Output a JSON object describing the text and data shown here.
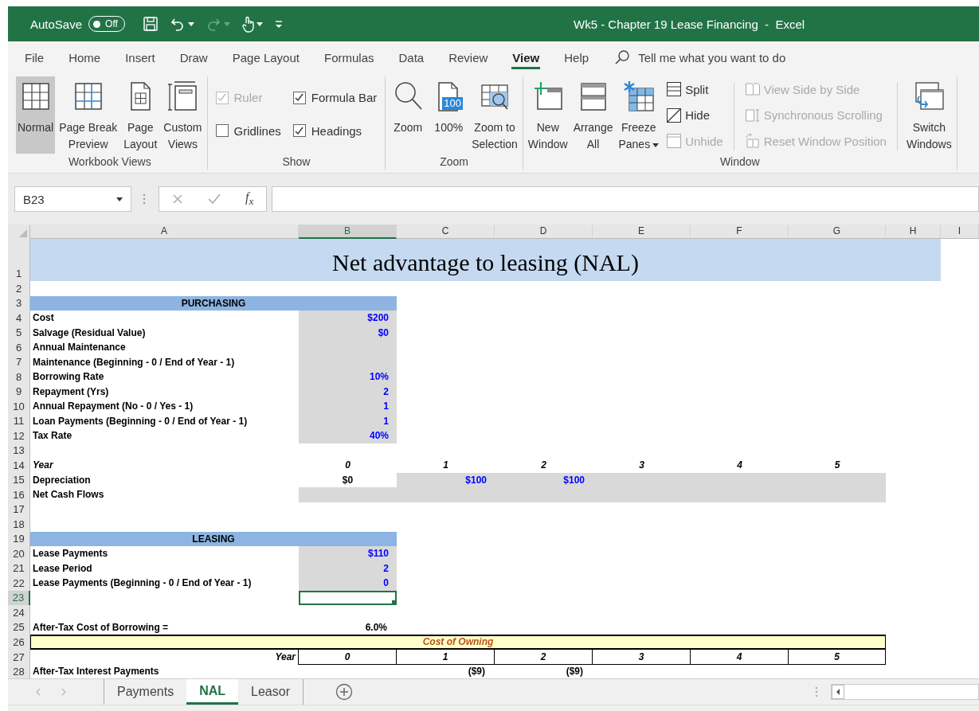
{
  "title_bar": {
    "autosave_label": "AutoSave",
    "autosave": {
      "text": "Off",
      "on": false
    },
    "quick_access": [
      {
        "kind": "save",
        "dropdown": false,
        "disabled": false
      },
      {
        "kind": "undo",
        "dropdown": true,
        "disabled": false
      },
      {
        "kind": "redo",
        "dropdown": true,
        "disabled": true
      },
      {
        "kind": "touch",
        "dropdown": true,
        "disabled": false
      },
      {
        "kind": "customize",
        "dropdown": false,
        "disabled": false
      }
    ],
    "title": "Wk5 - Chapter 19 Lease Financing  -  Excel"
  },
  "menu_tabs": [
    {
      "label": "File",
      "selected": false
    },
    {
      "label": "Home",
      "selected": false
    },
    {
      "label": "Insert",
      "selected": false
    },
    {
      "label": "Draw",
      "selected": false
    },
    {
      "label": "Page Layout",
      "selected": false
    },
    {
      "label": "Formulas",
      "selected": false
    },
    {
      "label": "Data",
      "selected": false
    },
    {
      "label": "Review",
      "selected": false
    },
    {
      "label": "View",
      "selected": true
    },
    {
      "label": "Help",
      "selected": false
    }
  ],
  "search": {
    "placeholder": "Tell me what you want to do"
  },
  "ribbon": {
    "groups": [
      {
        "label": "Workbook Views",
        "items": [
          {
            "kind": "large",
            "label": "Normal",
            "selected": true
          },
          {
            "kind": "large",
            "label": "Page Break\nPreview",
            "selected": false
          },
          {
            "kind": "large",
            "label": "Page\nLayout",
            "selected": false
          },
          {
            "kind": "large",
            "label": "Custom\nViews",
            "selected": false
          }
        ]
      },
      {
        "label": "Show",
        "items": [
          {
            "kind": "check",
            "label": "Ruler",
            "checked": true,
            "disabled": true
          },
          {
            "kind": "check",
            "label": "Gridlines",
            "checked": false,
            "disabled": false
          },
          {
            "kind": "check",
            "label": "Formula Bar",
            "checked": true,
            "disabled": false
          },
          {
            "kind": "check",
            "label": "Headings",
            "checked": true,
            "disabled": false
          }
        ]
      },
      {
        "label": "Zoom",
        "items": [
          {
            "kind": "large",
            "label": "Zoom",
            "selected": false
          },
          {
            "kind": "large",
            "label": "100%",
            "badge": "100",
            "selected": false
          },
          {
            "kind": "large",
            "label": "Zoom to\nSelection",
            "selected": false
          }
        ]
      },
      {
        "label": "Window",
        "items": [
          {
            "kind": "large",
            "label": "New\nWindow",
            "selected": false
          },
          {
            "kind": "large",
            "label": "Arrange\nAll",
            "selected": false
          },
          {
            "kind": "large",
            "label": "Freeze\nPanes",
            "dropdown": true,
            "selected": false
          },
          {
            "kind": "small",
            "label": "Split",
            "disabled": false
          },
          {
            "kind": "small",
            "label": "Hide",
            "disabled": false
          },
          {
            "kind": "small",
            "label": "Unhide",
            "disabled": true
          },
          {
            "kind": "small",
            "label": "View Side by Side",
            "disabled": true
          },
          {
            "kind": "small",
            "label": "Synchronous Scrolling",
            "disabled": true
          },
          {
            "kind": "small",
            "label": "Reset Window Position",
            "disabled": true
          },
          {
            "kind": "large",
            "label": "Switch\nWindows",
            "selected": false
          }
        ]
      }
    ]
  },
  "formula_bar": {
    "name_box": "B23",
    "function_label": "f$_{x}$"
  },
  "sheet": {
    "columns": [
      {
        "label": "A",
        "selected": false
      },
      {
        "label": "B",
        "selected": true
      },
      {
        "label": "C",
        "selected": false
      },
      {
        "label": "D",
        "selected": false
      },
      {
        "label": "E",
        "selected": false
      },
      {
        "label": "F",
        "selected": false
      },
      {
        "label": "G",
        "selected": false
      },
      {
        "label": "H",
        "selected": false
      },
      {
        "label": "I",
        "selected": false
      }
    ],
    "rows": [
      {
        "number": "1",
        "selected": false,
        "cells": [
          {
            "kind": "title",
            "text": "Net advantage to leasing (NAL)"
          }
        ]
      },
      {
        "number": "2",
        "selected": false
      },
      {
        "number": "3",
        "selected": false,
        "cells": [
          {
            "kind": "section",
            "text": "PURCHASING"
          }
        ]
      },
      {
        "number": "4",
        "selected": false,
        "cells": [
          {
            "kind": "label",
            "text": "Cost"
          },
          {
            "kind": "input",
            "text": "$200"
          }
        ]
      },
      {
        "number": "5",
        "selected": false,
        "cells": [
          {
            "kind": "label",
            "text": "Salvage (Residual Value)"
          },
          {
            "kind": "input",
            "text": "$0"
          }
        ]
      },
      {
        "number": "6",
        "selected": false,
        "cells": [
          {
            "kind": "label",
            "text": "Annual Maintenance"
          },
          {
            "kind": "input"
          }
        ]
      },
      {
        "number": "7",
        "selected": false,
        "cells": [
          {
            "kind": "label",
            "text": "Maintenance  (Beginning - 0 / End of Year  - 1)"
          },
          {
            "kind": "input"
          }
        ]
      },
      {
        "number": "8",
        "selected": false,
        "cells": [
          {
            "kind": "label",
            "text": "Borrowing Rate"
          },
          {
            "kind": "input",
            "text": "10%"
          }
        ]
      },
      {
        "number": "9",
        "selected": false,
        "cells": [
          {
            "kind": "label",
            "text": "Repayment (Yrs)"
          },
          {
            "kind": "input",
            "text": "2"
          }
        ]
      },
      {
        "number": "10",
        "selected": false,
        "cells": [
          {
            "kind": "label",
            "text": "Annual Repayment (No - 0 / Yes - 1)"
          },
          {
            "kind": "input",
            "text": "1"
          }
        ]
      },
      {
        "number": "11",
        "selected": false,
        "cells": [
          {
            "kind": "label",
            "text": "Loan Payments (Beginning - 0 / End of Year  - 1)"
          },
          {
            "kind": "input",
            "text": "1"
          }
        ]
      },
      {
        "number": "12",
        "selected": false,
        "cells": [
          {
            "kind": "label",
            "text": "Tax Rate"
          },
          {
            "kind": "input",
            "text": "40%"
          }
        ]
      },
      {
        "number": "13",
        "selected": false
      },
      {
        "number": "14",
        "selected": false,
        "cells": [
          {
            "kind": "label-italic",
            "text": "Year"
          },
          {
            "kind": "year",
            "text": "0"
          },
          {
            "kind": "year",
            "text": "1"
          },
          {
            "kind": "year",
            "text": "2"
          },
          {
            "kind": "year",
            "text": "3"
          },
          {
            "kind": "year",
            "text": "4"
          },
          {
            "kind": "year",
            "text": "5"
          }
        ]
      },
      {
        "number": "15",
        "selected": false,
        "cells": [
          {
            "kind": "label",
            "text": "Depreciation"
          },
          {
            "kind": "value",
            "text": "$0"
          },
          {
            "kind": "input",
            "text": "$100"
          },
          {
            "kind": "input",
            "text": "$100"
          },
          {
            "kind": "input"
          },
          {
            "kind": "input"
          },
          {
            "kind": "input"
          }
        ]
      },
      {
        "number": "16",
        "selected": false,
        "cells": [
          {
            "kind": "label",
            "text": "Net Cash Flows"
          },
          {
            "kind": "input"
          },
          {
            "kind": "input"
          },
          {
            "kind": "input"
          },
          {
            "kind": "input"
          },
          {
            "kind": "input"
          },
          {
            "kind": "input"
          }
        ]
      },
      {
        "number": "17",
        "selected": false
      },
      {
        "number": "18",
        "selected": false
      },
      {
        "number": "19",
        "selected": false,
        "cells": [
          {
            "kind": "section",
            "text": "LEASING"
          }
        ]
      },
      {
        "number": "20",
        "selected": false,
        "cells": [
          {
            "kind": "label",
            "text": "Lease Payments"
          },
          {
            "kind": "input",
            "text": "$110"
          }
        ]
      },
      {
        "number": "21",
        "selected": false,
        "cells": [
          {
            "kind": "label",
            "text": "Lease Period"
          },
          {
            "kind": "input",
            "text": "2"
          }
        ]
      },
      {
        "number": "22",
        "selected": false,
        "cells": [
          {
            "kind": "label",
            "text": "Lease Payments (Beginning - 0 / End of Year  - 1)"
          },
          {
            "kind": "input",
            "text": "0"
          }
        ]
      },
      {
        "number": "23",
        "selected": true
      },
      {
        "number": "24",
        "selected": false
      },
      {
        "number": "25",
        "selected": false,
        "cells": [
          {
            "kind": "label",
            "text": "After-Tax Cost of Borrowing ="
          },
          {
            "kind": "value-right",
            "text": "6.0%"
          }
        ]
      },
      {
        "number": "26",
        "selected": false,
        "cells": [
          {
            "kind": "band",
            "text": "Cost of Owning"
          }
        ]
      },
      {
        "number": "27",
        "selected": false,
        "cells": [
          {
            "kind": "label-right",
            "text": "Year"
          },
          {
            "kind": "year-box",
            "text": "0"
          },
          {
            "kind": "year-box",
            "text": "1"
          },
          {
            "kind": "year-box",
            "text": "2"
          },
          {
            "kind": "year-box",
            "text": "3"
          },
          {
            "kind": "year-box",
            "text": "4"
          },
          {
            "kind": "year-box",
            "text": "5"
          }
        ]
      },
      {
        "number": "28",
        "selected": false,
        "cells": [
          {
            "kind": "label",
            "text": "After-Tax Interest Payments"
          },
          {
            "kind": "blank"
          },
          {
            "kind": "value-right",
            "text": "($9)"
          },
          {
            "kind": "value-right",
            "text": "($9)"
          }
        ]
      }
    ]
  },
  "sheet_tabs": [
    {
      "label": "Payments",
      "selected": false
    },
    {
      "label": "NAL",
      "selected": true
    },
    {
      "label": "Leasor",
      "selected": false
    }
  ]
}
